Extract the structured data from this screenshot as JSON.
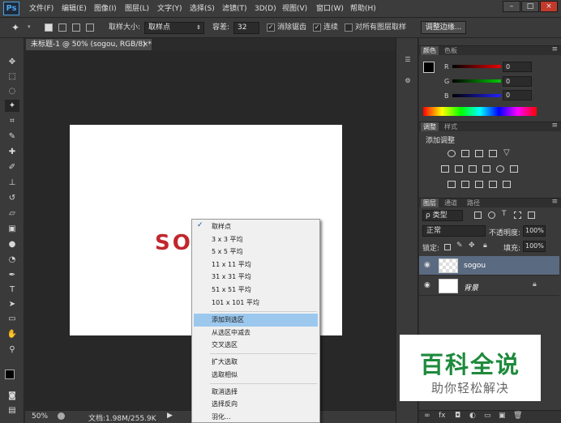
{
  "app": {
    "logo": "Ps"
  },
  "menu": [
    "文件(F)",
    "编辑(E)",
    "图像(I)",
    "图层(L)",
    "文字(Y)",
    "选择(S)",
    "滤镜(T)",
    "3D(D)",
    "视图(V)",
    "窗口(W)",
    "帮助(H)"
  ],
  "window_controls": {
    "minimize": "–",
    "restore": "□",
    "close": "×"
  },
  "options": {
    "sample_size_label": "取样大小:",
    "sample_size_value": "取样点",
    "tolerance_label": "容差:",
    "tolerance_value": "32",
    "antialias_label": "消除锯齿",
    "contiguous_label": "连续",
    "sample_all_label": "对所有图层取样",
    "refine_edge_label": "调整边缘..."
  },
  "document": {
    "tab_title": "未标题-1 @ 50% (sogou, RGB/8) *",
    "tab_close": "×",
    "canvas_text": "SO",
    "zoom": "50%",
    "doc_info": "文档:1.98M/255.9K"
  },
  "context_menu": {
    "items": [
      "取样点",
      "3 x 3 平均",
      "5 x 5 平均",
      "11 x 11 平均",
      "31 x 31 平均",
      "51 x 51 平均",
      "101 x 101 平均",
      "添加到选区",
      "从选区中减去",
      "交叉选区",
      "扩大选取",
      "选取相似",
      "取消选择",
      "选择反向",
      "羽化..."
    ],
    "checked": "✓"
  },
  "color_panel": {
    "tabs": [
      "颜色",
      "色板"
    ],
    "labels": [
      "R",
      "G",
      "B"
    ],
    "values": [
      "0",
      "0",
      "0"
    ]
  },
  "adjust_panel": {
    "tabs": [
      "调整",
      "样式"
    ],
    "title": "添加调整"
  },
  "layers_panel": {
    "tabs": [
      "图层",
      "通道",
      "路径"
    ],
    "filter_label": "ρ 类型",
    "blend_mode": "正常",
    "opacity_label": "不透明度:",
    "opacity_value": "100%",
    "lock_label": "锁定:",
    "fill_label": "填充:",
    "fill_value": "100%",
    "layers": [
      {
        "name": "sogou",
        "selected": true
      },
      {
        "name": "背景",
        "selected": false
      }
    ]
  },
  "watermark": {
    "title": "百科全说",
    "subtitle": "助你轻松解决"
  },
  "colors": {
    "accent": "#9cc8ee",
    "ps_blue": "#4aa3e8",
    "canvas_text": "#c0272d",
    "watermark_green": "#1e8a3c"
  }
}
